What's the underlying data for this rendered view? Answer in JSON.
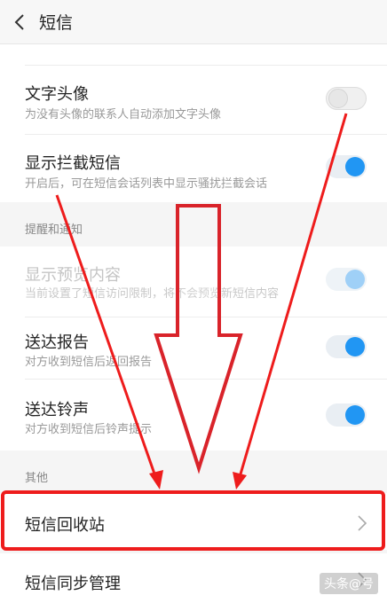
{
  "header": {
    "title": "短信"
  },
  "items": {
    "text_avatar": {
      "label": "文字头像",
      "desc": "为没有头像的联系人自动添加文字头像",
      "enabled": false
    },
    "show_blocked": {
      "label": "显示拦截短信",
      "desc": "开启后，可在短信会话列表中显示骚扰拦截会话",
      "enabled": true
    },
    "preview": {
      "label": "显示预览内容",
      "desc": "当前设置了短信访问限制，将不会预览新短信内容",
      "enabled": true,
      "disabled": true
    },
    "delivery_report": {
      "label": "送达报告",
      "desc": "对方收到短信后返回报告",
      "enabled": true
    },
    "delivery_tone": {
      "label": "送达铃声",
      "desc": "对方收到短信后铃声提示",
      "enabled": true
    }
  },
  "sections": {
    "reminders": "提醒和通知",
    "other": "其他"
  },
  "links": {
    "recycle_bin": "短信回收站",
    "sync": "短信同步管理"
  },
  "annotations": {
    "highlight_color": "#ee1c1c"
  },
  "watermark": "头条@号"
}
